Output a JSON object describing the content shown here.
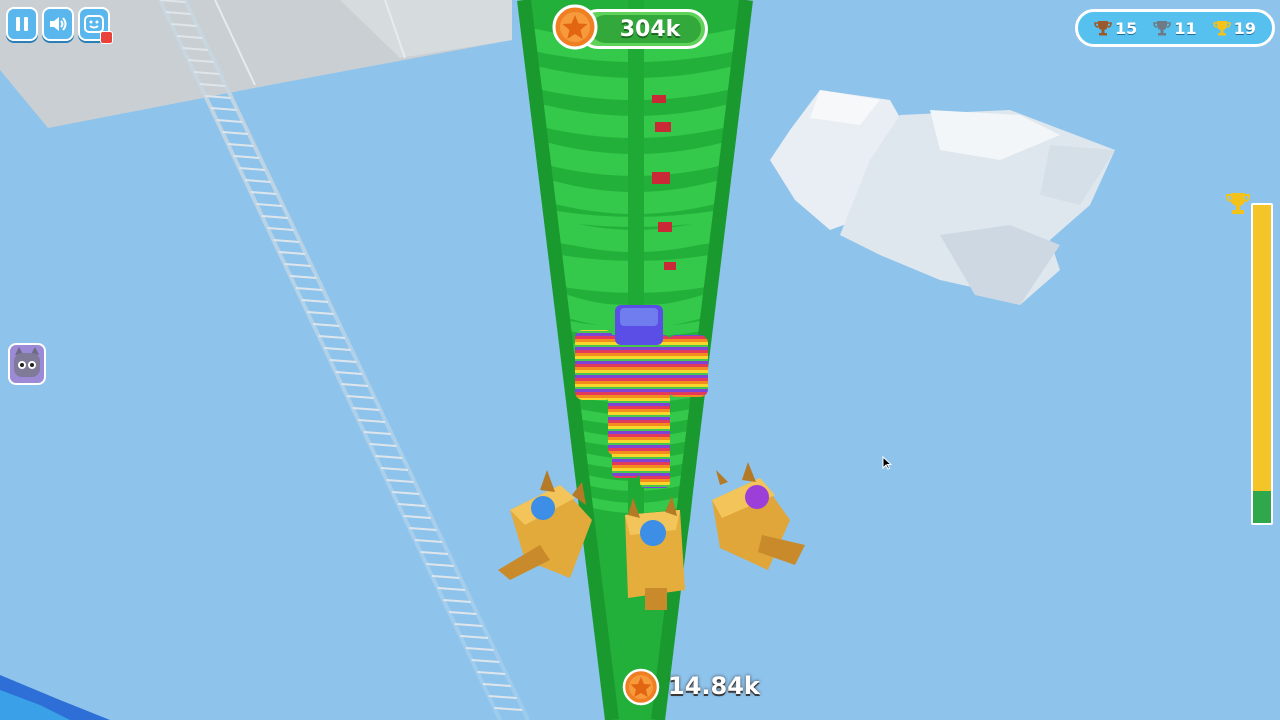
{
  "hud": {
    "coins": "304k",
    "trophies": {
      "bronze": "15",
      "silver": "11",
      "gold": "19"
    },
    "bottom_coins": "14.84k",
    "progress": 0.1
  },
  "colors": {
    "sky": "#8ec3ec",
    "tower": "#27b73a",
    "progress_bar": "#f5c428",
    "progress_fill": "#2ea84a",
    "coin": "#f07e22"
  },
  "icons": {
    "pause": "pause-icon",
    "sound": "speaker-icon",
    "video": "smile-video-icon",
    "coin": "star-coin-icon",
    "trophy": "trophy-icon",
    "pet": "cat-face-icon"
  }
}
